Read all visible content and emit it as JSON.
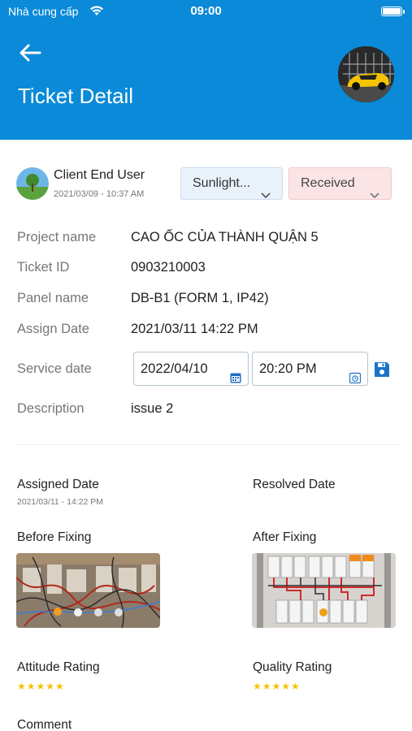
{
  "status_bar": {
    "carrier": "Nhà cung cấp",
    "time": "09:00"
  },
  "header": {
    "title": "Ticket Detail"
  },
  "user": {
    "name": "Client End User",
    "date": "2021/03/09 - 10:37 AM"
  },
  "dropdowns": {
    "project": "Sunlight...",
    "status": "Received"
  },
  "details": [
    {
      "label": "Project name",
      "value": "CAO ỐC CỦA THÀNH QUẬN 5"
    },
    {
      "label": "Ticket ID",
      "value": "0903210003"
    },
    {
      "label": "Panel name",
      "value": "DB-B1 (FORM 1, IP42)"
    },
    {
      "label": "Assign Date",
      "value": "2021/03/11 14:22 PM"
    }
  ],
  "service": {
    "label": "Service date",
    "date": "2022/04/10",
    "time": "20:20 PM"
  },
  "description": {
    "label": "Description",
    "value": "issue 2"
  },
  "dates": {
    "assigned_label": "Assigned Date",
    "assigned_value": "2021/03/11 - 14:22 PM",
    "resolved_label": "Resolved Date"
  },
  "photos": {
    "before_label": "Before Fixing",
    "after_label": "After Fixing"
  },
  "ratings": {
    "attitude_label": "Attitude Rating",
    "attitude_stars": "★★★★★",
    "attitude_value": 5,
    "quality_label": "Quality Rating",
    "quality_stars": "★★★★★",
    "quality_value": 5
  },
  "comment": {
    "label": "Comment"
  },
  "colors": {
    "primary": "#0a8ad8",
    "star": "#f3c300",
    "status_bg": "#fbe4e6",
    "project_bg": "#e9f2fb"
  }
}
